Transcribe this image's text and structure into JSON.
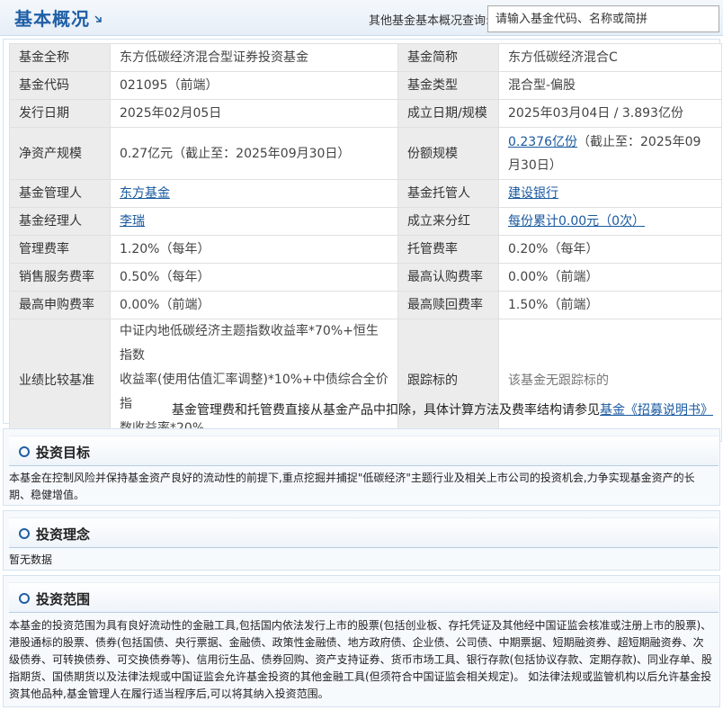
{
  "header": {
    "title": "基本概况",
    "search_label": "其他基金基本概况查询:",
    "search_placeholder": "请输入基金代码、名称或简拼"
  },
  "overview": {
    "fund_full_name_label": "基金全称",
    "fund_full_name": "东方低碳经济混合型证券投资基金",
    "fund_short_name_label": "基金简称",
    "fund_short_name": "东方低碳经济混合C",
    "fund_code_label": "基金代码",
    "fund_code": "021095（前端）",
    "fund_type_label": "基金类型",
    "fund_type": "混合型-偏股",
    "issue_date_label": "发行日期",
    "issue_date": "2025年02月05日",
    "setup_label": "成立日期/规模",
    "setup_value": "2025年03月04日 / 3.893亿份",
    "net_assets_label": "净资产规模",
    "net_assets": "0.27亿元（截止至：2025年09月30日）",
    "share_scale_label": "份额规模",
    "share_scale_link": "0.2376亿份",
    "share_scale_rest": "（截止至：2025年09月30日）",
    "manager_company_label": "基金管理人",
    "manager_company": "东方基金",
    "custodian_label": "基金托管人",
    "custodian": "建设银行",
    "manager_label": "基金经理人",
    "manager": "李瑞",
    "dividend_label": "成立来分红",
    "dividend": "每份累计0.00元（0次）",
    "mgmt_fee_label": "管理费率",
    "mgmt_fee": "1.20%（每年）",
    "custody_fee_label": "托管费率",
    "custody_fee": "0.20%（每年）",
    "sales_fee_label": "销售服务费率",
    "sales_fee": "0.50%（每年）",
    "max_subscribe_label": "最高认购费率",
    "max_subscribe": "0.00%（前端）",
    "max_purchase_label": "最高申购费率",
    "max_purchase": "0.00%（前端）",
    "max_redeem_label": "最高赎回费率",
    "max_redeem": "1.50%（前端）",
    "benchmark_label": "业绩比较基准",
    "benchmark_line1": "中证内地低碳经济主题指数收益率*70%+恒生指数",
    "benchmark_line2": "收益率(使用估值汇率调整)*10%+中债综合全价指",
    "benchmark_line3": "数收益率*20%",
    "tracking_label": "跟踪标的",
    "tracking": "该基金无跟踪标的",
    "fee_note": "基金管理费和托管费直接从基金产品中扣除，具体计算方法及费率结构请参见",
    "fee_note_link": "基金《招募说明书》"
  },
  "sections": {
    "objective_title": "投资目标",
    "objective_text": "本基金在控制风险并保持基金资产良好的流动性的前提下,重点挖掘并捕捉\"低碳经济\"主题行业及相关上市公司的投资机会,力争实现基金资产的长期、稳健增值。",
    "philosophy_title": "投资理念",
    "philosophy_text": "暂无数据",
    "scope_title": "投资范围",
    "scope_text": "本基金的投资范围为具有良好流动性的金融工具,包括国内依法发行上市的股票(包括创业板、存托凭证及其他经中国证监会核准或注册上市的股票)、港股通标的股票、债券(包括国债、央行票据、金融债、政策性金融债、地方政府债、企业债、公司债、中期票据、短期融资券、超短期融资券、次级债券、可转换债券、可交换债券等)、信用衍生品、债券回购、资产支持证券、货币市场工具、银行存款(包括协议存款、定期存款)、同业存单、股指期货、国债期货以及法律法规或中国证监会允许基金投资的其他金融工具(但须符合中国证监会相关规定)。 如法律法规或监管机构以后允许基金投资其他品种,基金管理人在履行适当程序后,可以将其纳入投资范围。"
  },
  "colors": {
    "accent": "#1f5fa5",
    "label_bg": "#ececec",
    "link": "#1a5aa0"
  }
}
